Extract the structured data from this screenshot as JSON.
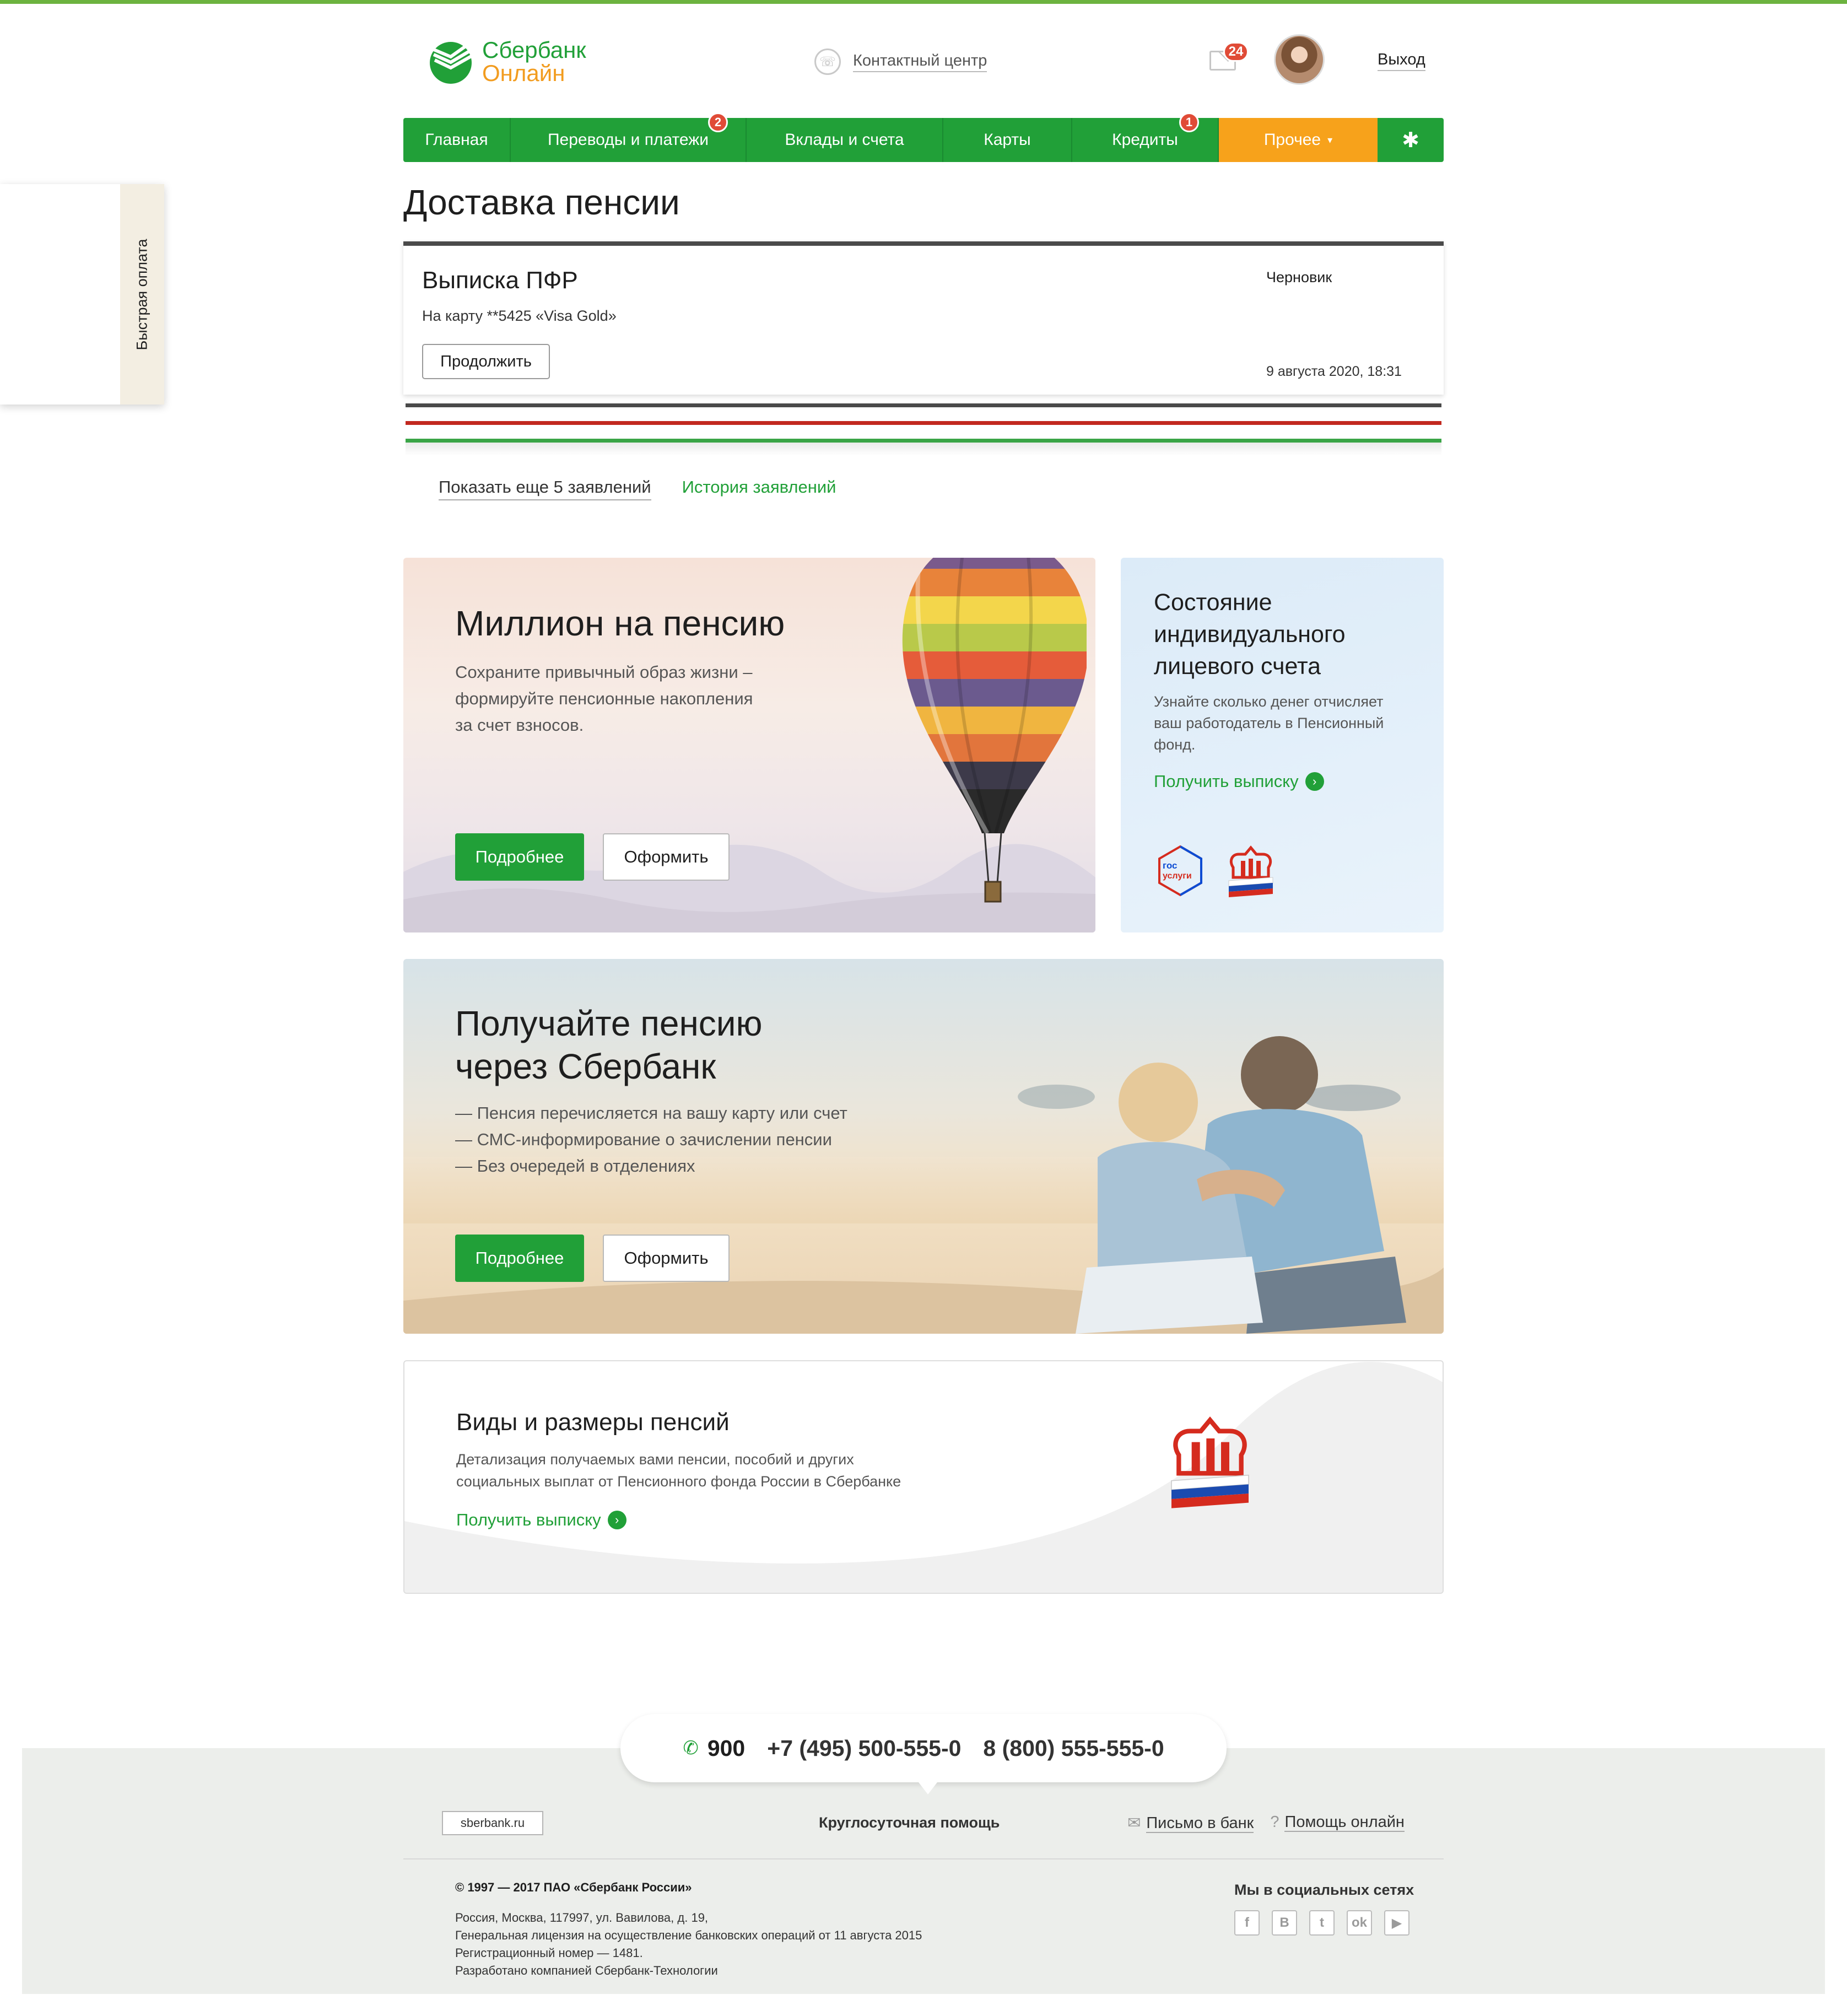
{
  "header": {
    "logo_line1": "Сбербанк",
    "logo_line2": "Онлайн",
    "contact_center": "Контактный центр",
    "mail_count": "24",
    "logout": "Выход"
  },
  "nav": {
    "items": [
      {
        "label": "Главная"
      },
      {
        "label": "Переводы и платежи",
        "badge": "2"
      },
      {
        "label": "Вклады и счета"
      },
      {
        "label": "Карты"
      },
      {
        "label": "Кредиты",
        "badge": "1"
      },
      {
        "label": "Прочее"
      }
    ],
    "settings_icon": "gear-icon"
  },
  "quick_pay": {
    "label": "Быстрая оплата"
  },
  "page": {
    "title": "Доставка пенсии"
  },
  "application": {
    "title": "Выписка ПФР",
    "subtitle": "На карту **5425 «Visa Gold»",
    "status": "Черновик",
    "date": "9 августа 2020, 18:31",
    "continue_button": "Продолжить"
  },
  "stack_colors": [
    "#4a4a4a",
    "#c2281f",
    "#3aa547"
  ],
  "links": {
    "show_more": "Показать еще 5 заявлений",
    "history": "История заявлений"
  },
  "promo_million": {
    "title": "Миллион на пенсию",
    "text_lines": [
      "Сохраните привычный образ жизни –",
      "формируйте пенсионные накопления",
      "за счет взносов."
    ],
    "btn_more": "Подробнее",
    "btn_apply": "Оформить"
  },
  "account_card": {
    "title_lines": [
      "Состояние",
      "индивидуального",
      "лицевого счета"
    ],
    "text_lines": [
      "Узнайте сколько денег отчисляет",
      "ваш работодатель в Пенсионный",
      "фонд."
    ],
    "link": "Получить выписку",
    "gos_line1": "гос",
    "gos_line2": "услуги"
  },
  "promo_pension": {
    "title_lines": [
      "Получайте пенсию",
      "через Сбербанк"
    ],
    "bullets": [
      "— Пенсия перечисляется на вашу карту или счет",
      "— СМС-информирование о зачислении пенсии",
      "— Без очередей в отделениях"
    ],
    "btn_more": "Подробнее",
    "btn_apply": "Оформить"
  },
  "pension_types": {
    "title": "Виды и размеры пенсий",
    "text_lines": [
      "Детализация получаемых вами пенсии, пособий и других",
      "социальных выплат от Пенсионного фонда России в Сбербанке"
    ],
    "link": "Получить выписку"
  },
  "footer": {
    "phone_short": "900",
    "phone_moscow": "+7 (495) 500-555-0",
    "phone_free": "8 (800) 555-555-0",
    "site": "sberbank.ru",
    "support": "Круглосуточная помощь",
    "letter": "Письмо в банк",
    "help": "Помощь онлайн",
    "copyright": "© 1997 — 2017 ПАО «Сбербанк России»",
    "address_lines": [
      "Россия, Москва, 117997, ул. Вавилова, д. 19,",
      "Генеральная лицензия на осуществление банковских операций от 11 августа 2015",
      "Регистрационный номер — 1481.",
      "Разработано компанией Сбербанк-Технологии"
    ],
    "social_title": "Мы в социальных сетях",
    "social": [
      {
        "icon": "facebook-icon",
        "glyph": "f"
      },
      {
        "icon": "vk-icon",
        "glyph": "В"
      },
      {
        "icon": "twitter-icon",
        "glyph": "t"
      },
      {
        "icon": "odnoklassniki-icon",
        "glyph": "ok"
      },
      {
        "icon": "youtube-icon",
        "glyph": "▶"
      }
    ]
  }
}
